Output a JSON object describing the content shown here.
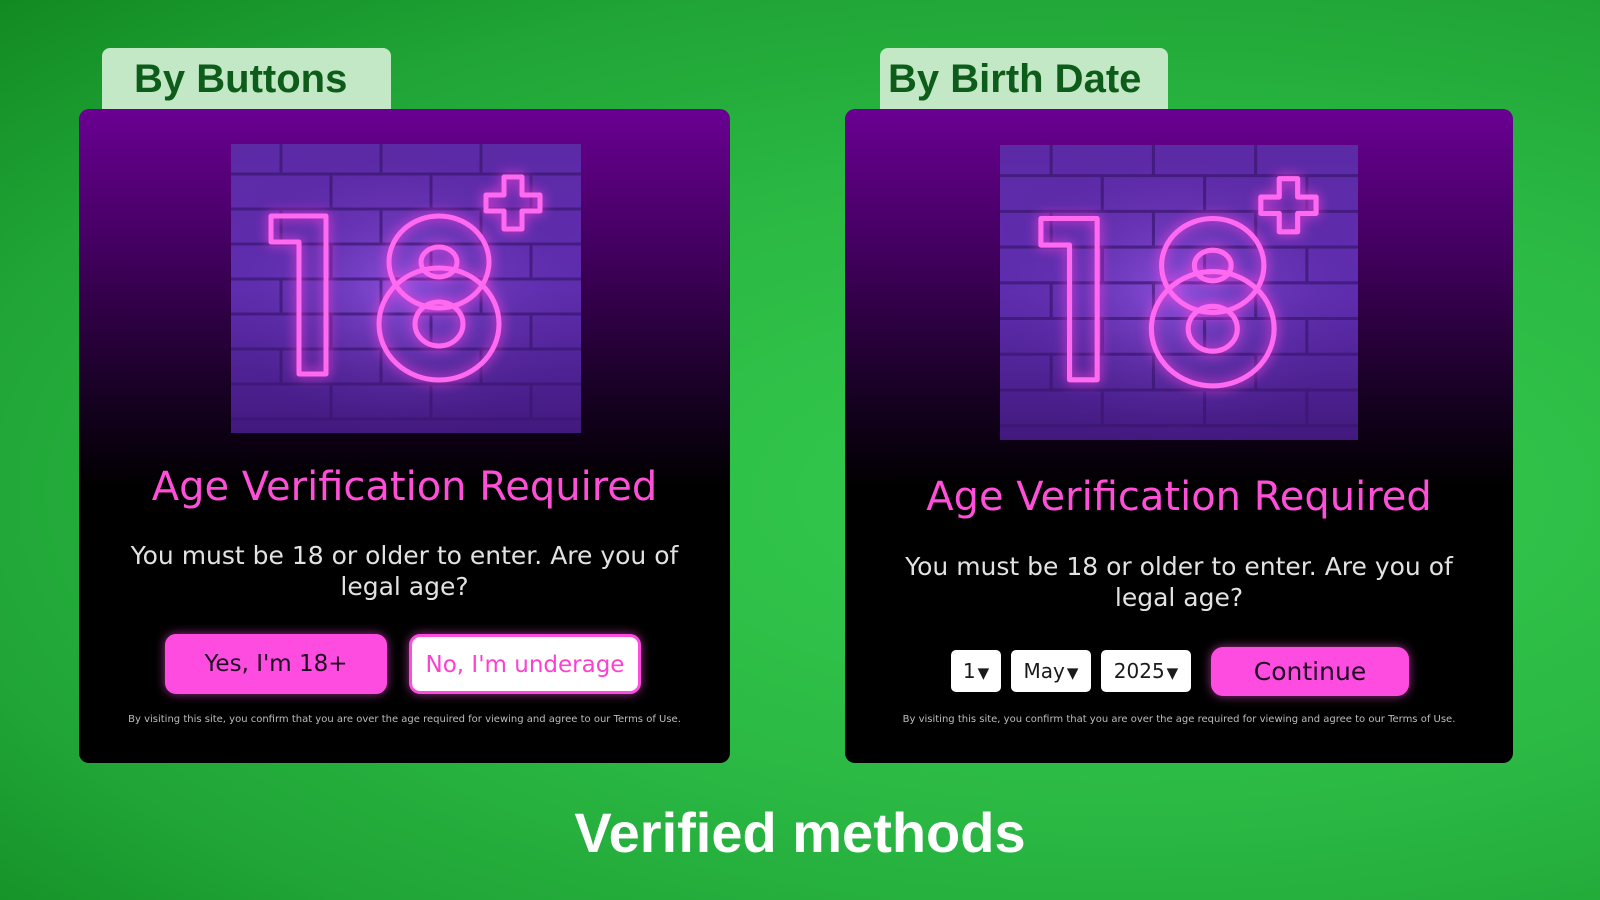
{
  "tabs": {
    "left": "By Buttons",
    "right": "By Birth Date"
  },
  "panels": {
    "buttons": {
      "title": "Age Verification Required",
      "subtitle": "You must be 18 or older to enter. Are you of legal age?",
      "yes_label": "Yes, I'm 18+",
      "no_label": "No, I'm underage",
      "disclaimer": "By visiting this site, you confirm that you are over the age required for viewing and agree to our Terms of Use."
    },
    "birthdate": {
      "title": "Age Verification Required",
      "subtitle": "You must be 18 or older to enter. Are you of legal age?",
      "day_value": "1",
      "month_value": "May",
      "year_value": "2025",
      "continue_label": "Continue",
      "disclaimer": "By visiting this site, you confirm that you are over the age required for viewing and agree to our Terms of Use."
    }
  },
  "hero": {
    "number": "18",
    "plus": "+"
  },
  "caption": "Verified methods",
  "icons": {
    "select_caret": "▼"
  },
  "colors": {
    "accent_pink": "#ff4ce0",
    "background_green": "#2bb944",
    "tab_background": "#c2e8c6",
    "tab_text": "#0e5c1a"
  }
}
